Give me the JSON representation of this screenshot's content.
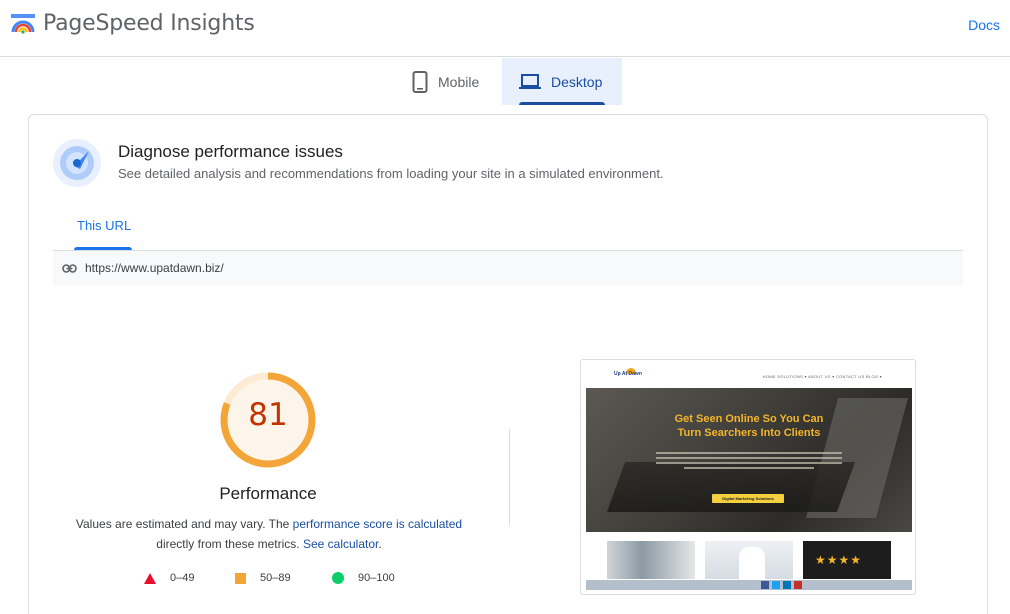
{
  "header": {
    "app_title": "PageSpeed Insights",
    "docs_link": "Docs"
  },
  "device_tabs": {
    "mobile_label": "Mobile",
    "desktop_label": "Desktop",
    "selected": "Desktop"
  },
  "diagnose": {
    "title": "Diagnose performance issues",
    "subtitle": "See detailed analysis and recommendations from loading your site in a simulated environment."
  },
  "url_tabs": {
    "active_label": "This URL"
  },
  "url": "https://www.upatdawn.biz/",
  "performance": {
    "score": 81,
    "score_text": "81",
    "score_fraction": 0.81,
    "label": "Performance",
    "estimate_prefix": "Values are estimated and may vary. The ",
    "estimate_link": "performance score is calculated",
    "estimate_middle": "directly from these metrics.",
    "calculator_link": "See calculator",
    "estimate_suffix": "."
  },
  "legend": [
    {
      "range": "0–49",
      "color": "#e8112d"
    },
    {
      "range": "50–89",
      "color": "#f4a538"
    },
    {
      "range": "90–100",
      "color": "#0cce6b"
    }
  ],
  "thumbnail": {
    "headline": "Get Seen Online So You Can Turn Searchers Into Clients",
    "menu": "HOME   SOLUTIONS ▾   ABOUT US ▾   CONTACT US   BLOG ▾",
    "cta": "Digital Marketing Solutions",
    "logo": "Up At Dawn"
  },
  "colors": {
    "accent": "#1a73e8",
    "gauge_average": "#f4a538",
    "score_text": "#c33300",
    "selected_tab_bg": "#e8f0fe"
  }
}
